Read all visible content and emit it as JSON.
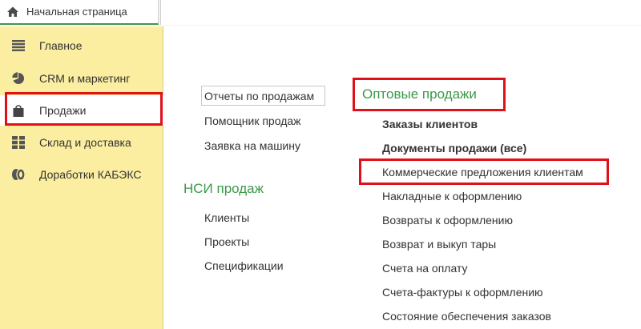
{
  "tabs": {
    "home_label": "Начальная страница"
  },
  "sidebar": {
    "items": [
      {
        "label": "Главное",
        "icon": "menu-lines-icon"
      },
      {
        "label": "CRM и маркетинг",
        "icon": "pie-chart-icon"
      },
      {
        "label": "Продажи",
        "icon": "shopping-bag-icon"
      },
      {
        "label": "Склад и доставка",
        "icon": "warehouse-grid-icon"
      },
      {
        "label": "Доработки КАБЭКС",
        "icon": "coins-icon"
      }
    ],
    "selected": "Продажи"
  },
  "main": {
    "left_links": [
      "Отчеты по продажам",
      "Помощник продаж",
      "Заявка на машину"
    ],
    "nsi": {
      "title": "НСИ продаж",
      "links": [
        "Клиенты",
        "Проекты",
        "Спецификации"
      ]
    },
    "wholesale": {
      "title": "Оптовые продажи",
      "links": [
        "Заказы клиентов",
        "Документы продажи (все)",
        "Коммерческие предложения клиентам",
        "Накладные к оформлению",
        "Возвраты к оформлению",
        "Возврат и выкуп тары",
        "Счета на оплату",
        "Счета-фактуры к оформлению",
        "Состояние обеспечения заказов"
      ]
    }
  },
  "colors": {
    "sidebar_bg": "#fbeea0",
    "accent_green": "#3a9a48",
    "highlight_red": "#e0101a"
  }
}
